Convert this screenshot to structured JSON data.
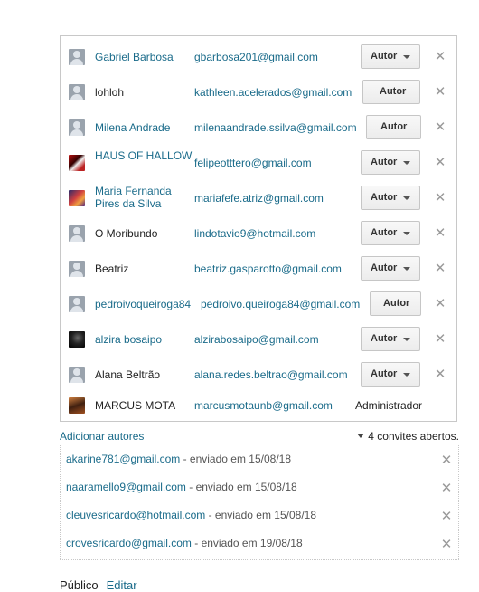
{
  "authors": [
    {
      "name": "Gabriel Barbosa",
      "name_style": "link",
      "avatar": "default-user-avatar",
      "email": "gbarbosa201@gmail.com",
      "role": "Autor",
      "dropdown": true
    },
    {
      "name": "lohloh",
      "name_style": "plain",
      "avatar": "default-user-avatar",
      "email": "kathleen.acelerados@gmail.com",
      "role": "Autor",
      "dropdown": false
    },
    {
      "name": "Milena Andrade",
      "name_style": "link",
      "avatar": "default-user-avatar",
      "email": "milenaandrade.ssilva@gmail.com",
      "role": "Autor",
      "dropdown": false
    },
    {
      "name": "HAUS OF HALLOW",
      "name_style": "link",
      "avatar": "photo-avatar",
      "email": "felipeotttero@gmail.com",
      "role": "Autor",
      "dropdown": true
    },
    {
      "name": "Maria Fernanda Pires da Silva",
      "name_style": "link",
      "avatar": "photo-avatar",
      "email": "mariafefe.atriz@gmail.com",
      "role": "Autor",
      "dropdown": true
    },
    {
      "name": "O Moribundo",
      "name_style": "plain",
      "avatar": "default-user-avatar",
      "email": "lindotavio9@hotmail.com",
      "role": "Autor",
      "dropdown": true
    },
    {
      "name": "Beatriz",
      "name_style": "plain",
      "avatar": "default-user-avatar",
      "email": "beatriz.gasparotto@gmail.com",
      "role": "Autor",
      "dropdown": true
    },
    {
      "name": "pedroivoqueiroga84",
      "name_style": "link",
      "avatar": "default-user-avatar",
      "email": "pedroivo.queiroga84@gmail.com",
      "role": "Autor",
      "dropdown": false
    },
    {
      "name": "alzira bosaipo",
      "name_style": "link",
      "avatar": "photo-avatar",
      "email": "alzirabosaipo@gmail.com",
      "role": "Autor",
      "dropdown": true
    },
    {
      "name": "Alana Beltrão",
      "name_style": "plain",
      "avatar": "default-user-avatar",
      "email": "alana.redes.beltrao@gmail.com",
      "role": "Autor",
      "dropdown": true
    }
  ],
  "admin": {
    "name": "MARCUS MOTA",
    "email": "marcusmotaunb@gmail.com",
    "role": "Administrador",
    "avatar": "photo-avatar"
  },
  "add_authors_label": "Adicionar autores",
  "open_invites_label": "4 convites abertos.",
  "invites": [
    {
      "email": "akarine781@gmail.com",
      "separator": " - ",
      "sent": "enviado em 15/08/18"
    },
    {
      "email": "naaramello9@gmail.com",
      "separator": " - ",
      "sent": "enviado em 15/08/18"
    },
    {
      "email": "cleuvesricardo@hotmail.com",
      "separator": " - ",
      "sent": "enviado em 15/08/18"
    },
    {
      "email": "crovesricardo@gmail.com",
      "separator": " - ",
      "sent": "enviado em 19/08/18"
    }
  ],
  "privacy": {
    "label": "Público",
    "edit_label": "Editar"
  },
  "icons": {
    "remove": "close-icon",
    "caret": "chevron-down-icon",
    "expand": "triangle-down-icon"
  },
  "colors": {
    "link": "#1a6b8a",
    "border": "#c8c8c8",
    "remove": "#9a9a9a"
  }
}
